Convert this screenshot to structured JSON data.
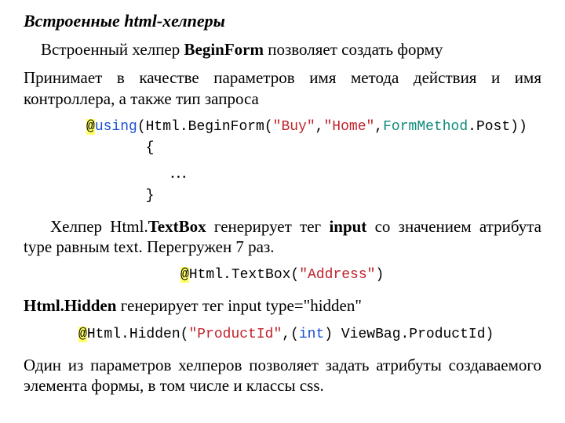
{
  "heading": "Встроенные html-хелперы",
  "para1_pre": "Встроенный хелпер ",
  "para1_bold": "BeginForm",
  "para1_post": " позволяет создать форму",
  "para2": "Принимает в качестве параметров имя метода действия и имя контроллера, а также тип запроса",
  "code1": {
    "at": "@",
    "using": "using",
    "open": "(Html.BeginForm(",
    "buy": "\"Buy\"",
    "comma1": ",",
    "home": "\"Home\"",
    "comma2": ",",
    "fm": "FormMethod",
    "post": ".Post))",
    "lb": "{",
    "dots": "…",
    "rb": "}"
  },
  "para3_a": "Хелпер Html.",
  "para3_b": "TextBox",
  "para3_c": " генерирует     тег ",
  "para3_d": "input",
  "para3_e": " со     значением атрибута type равным text. Перегружен 7 раз.",
  "code2": {
    "at": "@",
    "pre": "Html.TextBox(",
    "str": "\"Address\"",
    "post": ")"
  },
  "para4_a": "Html.Hidden",
  "para4_b": " генерирует тег input type=\"hidden\"",
  "code3": {
    "at": "@",
    "pre": "Html.Hidden(",
    "str": "\"ProductId\"",
    "mid": ",(",
    "int": "int",
    "post": ") ViewBag.ProductId)"
  },
  "para5": "Один из параметров хелперов позволяет задать атрибуты создаваемого элемента формы, в том числе и классы css."
}
